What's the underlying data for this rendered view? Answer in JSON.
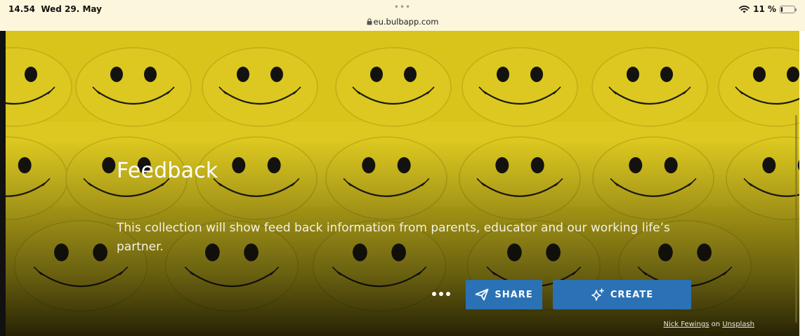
{
  "status_bar": {
    "time": "14.54",
    "date": "Wed 29. May",
    "dots": "•••",
    "url": "eu.bulbapp.com",
    "battery": "11 %",
    "battery_level": 0.11
  },
  "hero": {
    "title": "Feedback",
    "description": "This collection will show feed back information from parents, educator and our working life’s partner.",
    "share_label": "SHARE",
    "create_label": "CREATE",
    "credit": {
      "author": "Nick Fewings",
      "on": "on",
      "source": "Unsplash"
    }
  },
  "colors": {
    "status_bar_bg": "#fbf6dc",
    "image_yellow": "#d7c31a",
    "button_blue": "#2a72b5",
    "text_white": "#ffffff"
  },
  "icons": {
    "wifi": "wifi-icon",
    "battery": "battery-icon",
    "lock": "lock-icon",
    "share": "paper-plane-icon",
    "create": "sparkle-icon",
    "more": "more-dots-icon"
  }
}
